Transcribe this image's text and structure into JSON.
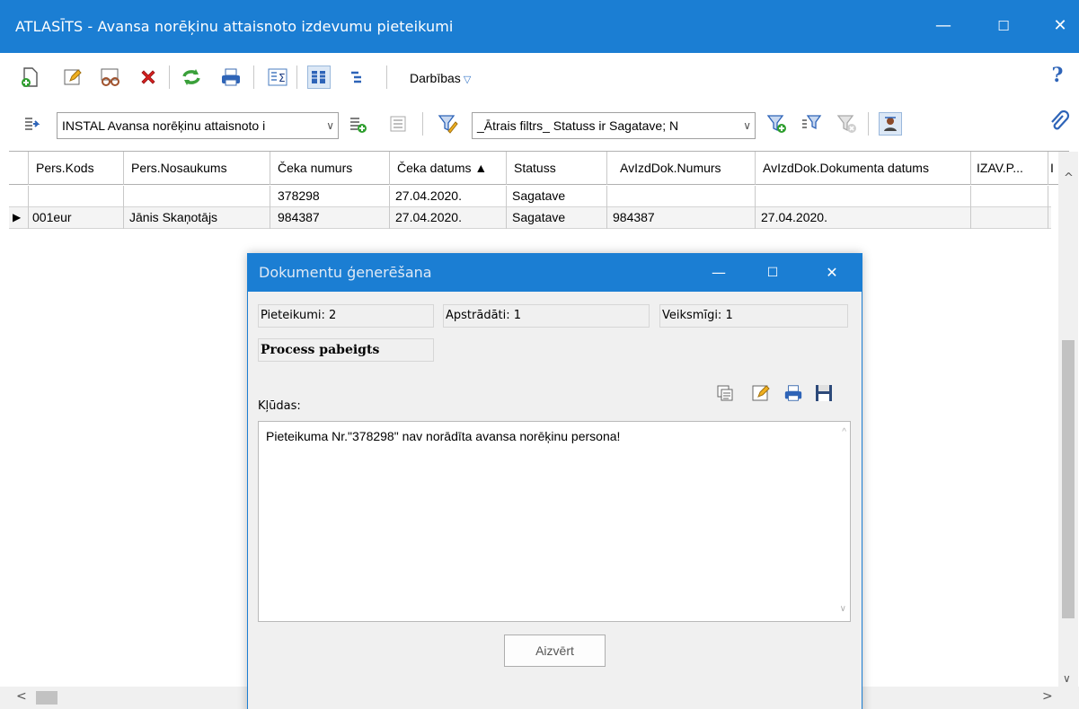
{
  "window": {
    "title": "ATLASĪTS - Avansa norēķinu attaisnoto izdevumu pieteikumi",
    "minimize": "—",
    "maximize": "☐",
    "close": "✕"
  },
  "toolbar": {
    "actions_label": "Darbības",
    "actions_caret": "▽",
    "help_icon": "?"
  },
  "filterbar": {
    "view_combo": "INSTAL Avansa norēķinu attaisnoto i",
    "filter_combo": "_Ātrais filtrs_ Statuss ir Sagatave; N",
    "combo_arrow": "∨"
  },
  "grid": {
    "columns": [
      "Pers.Kods",
      "Pers.Nosaukums",
      "Čeka numurs",
      "Čeka datums ▲",
      "Statuss",
      "AvIzdDok.Numurs",
      "AvIzdDok.Dokumenta datums",
      "IZAV.P...",
      "I"
    ],
    "rows": [
      [
        "",
        "",
        "378298",
        "27.04.2020.",
        "Sagatave",
        "",
        "",
        "",
        ""
      ],
      [
        "001eur",
        "Jānis Skaņotājs",
        "984387",
        "27.04.2020.",
        "Sagatave",
        "984387",
        "27.04.2020.",
        "",
        ""
      ]
    ],
    "row_pointer": "▶",
    "scroll_up": "^",
    "scroll_down": "∨",
    "scroll_left": "<",
    "scroll_right": ">"
  },
  "dialog": {
    "title": "Dokumentu ģenerēšana",
    "minimize": "—",
    "maximize": "☐",
    "close": "✕",
    "stats": {
      "requests": "Pieteikumi: 2",
      "processed": "Apstrādāti: 1",
      "successful": "Veiksmīgi: 1"
    },
    "status": "Process pabeigts",
    "errors_label": "Kļūdas:",
    "error_text": "Pieteikuma Nr.\"378298\" nav norādīta avansa norēķinu persona!",
    "close_button": "Aizvērt"
  },
  "colors": {
    "titlebar": "#1b7ed3",
    "accent": "#1b7ed3"
  },
  "icons": [
    "new-doc-icon",
    "edit-icon",
    "view-icon",
    "delete-icon",
    "refresh-icon",
    "print-icon",
    "sum-icon",
    "columns-icon",
    "tree-icon",
    "help-icon",
    "export-icon",
    "add-view-icon",
    "view-list-icon",
    "filter-icon",
    "add-filter-icon",
    "filter-edit-icon",
    "filter-clear-icon",
    "filter-user-icon",
    "attach-icon",
    "copy-icon",
    "edit-text-icon",
    "print-text-icon",
    "save-icon"
  ]
}
